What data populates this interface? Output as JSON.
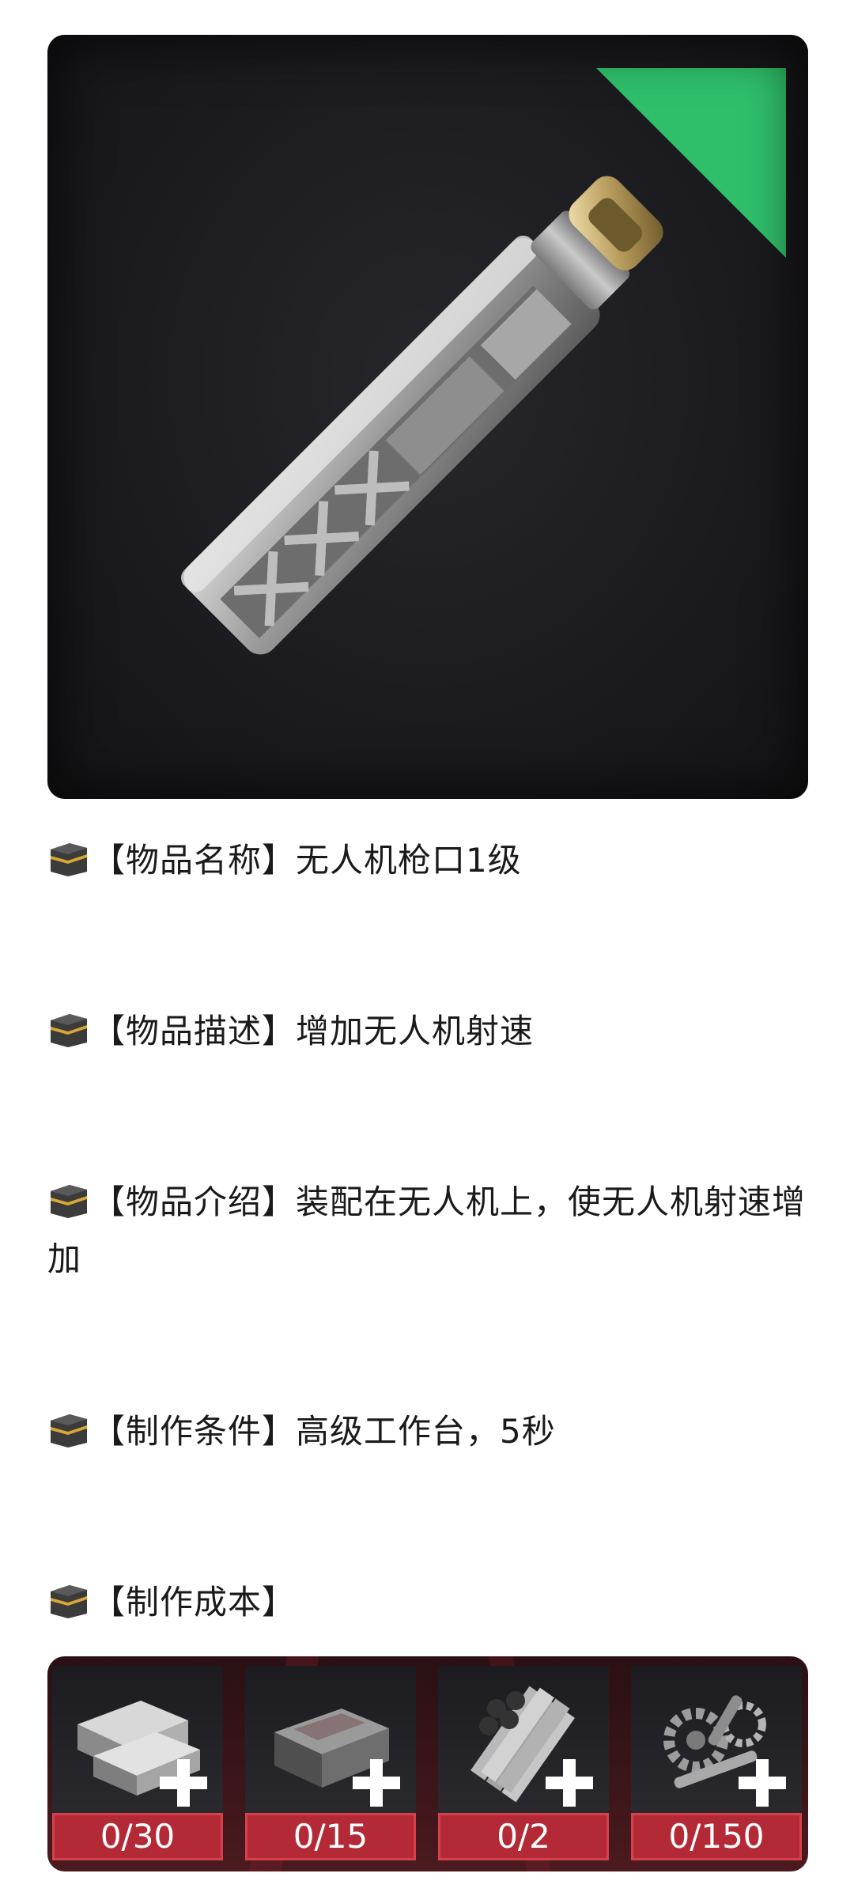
{
  "item": {
    "rarity_color": "#2fbf6a",
    "art": "drone-muzzle-icon"
  },
  "rows": {
    "name": {
      "tag": "【物品名称】",
      "value": "无人机枪口1级"
    },
    "desc": {
      "tag": "【物品描述】",
      "value": "增加无人机射速"
    },
    "intro": {
      "tag": "【物品介绍】",
      "value": "装配在无人机上，使无人机射速增加"
    },
    "cond": {
      "tag": "【制作条件】",
      "value": "高级工作台，5秒"
    },
    "cost": {
      "tag": "【制作成本】",
      "value": ""
    }
  },
  "costs": [
    {
      "icon": "metal-ingot-icon",
      "count": "0/30"
    },
    {
      "icon": "steel-block-icon",
      "count": "0/15"
    },
    {
      "icon": "pipe-bundle-icon",
      "count": "0/2"
    },
    {
      "icon": "gear-parts-icon",
      "count": "0/150"
    }
  ],
  "colors": {
    "count_badge": "#b32a36",
    "panel": "#3a1519"
  }
}
